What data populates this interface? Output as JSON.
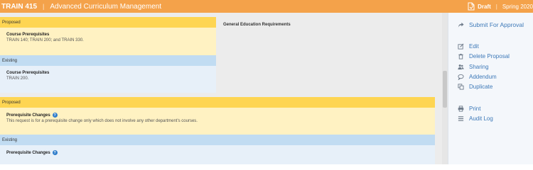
{
  "header": {
    "course_code": "TRAIN 415",
    "separator": "|",
    "app_title": "Advanced Curriculum Management",
    "status": "Draft",
    "divider": "|",
    "term": "Spring 2020"
  },
  "sections": [
    {
      "proposed_label": "Proposed",
      "proposed_heading": "Course Prerequisites",
      "proposed_text": "TRAIN 140; TRAIN 200; and TRAIN 330.",
      "existing_label": "Existing",
      "existing_heading": "Course Prerequisites",
      "existing_text": "TRAIN 200."
    },
    {
      "proposed_label": "Proposed",
      "proposed_heading": "Prerequisite Changes",
      "proposed_text": "This request is for a prerequisite change only which does not involve any other department's courses.",
      "existing_label": "Existing",
      "existing_heading": "Prerequisite Changes"
    }
  ],
  "right_column_heading": "General Education Requirements",
  "sidebar": {
    "submit": "Submit For Approval",
    "edit": "Edit",
    "delete": "Delete Proposal",
    "sharing": "Sharing",
    "addendum": "Addendum",
    "duplicate": "Duplicate",
    "print": "Print",
    "audit_log": "Audit Log"
  },
  "icons": [
    "document-icon",
    "share-arrow-icon",
    "edit-icon",
    "trash-icon",
    "users-icon",
    "comment-icon",
    "copy-icon",
    "print-icon",
    "list-icon",
    "help-icon"
  ],
  "colors": {
    "header": "#f4a24a",
    "proposed_band": "#fed552",
    "existing_band": "#c1dcf2",
    "link": "#3d79b8"
  }
}
